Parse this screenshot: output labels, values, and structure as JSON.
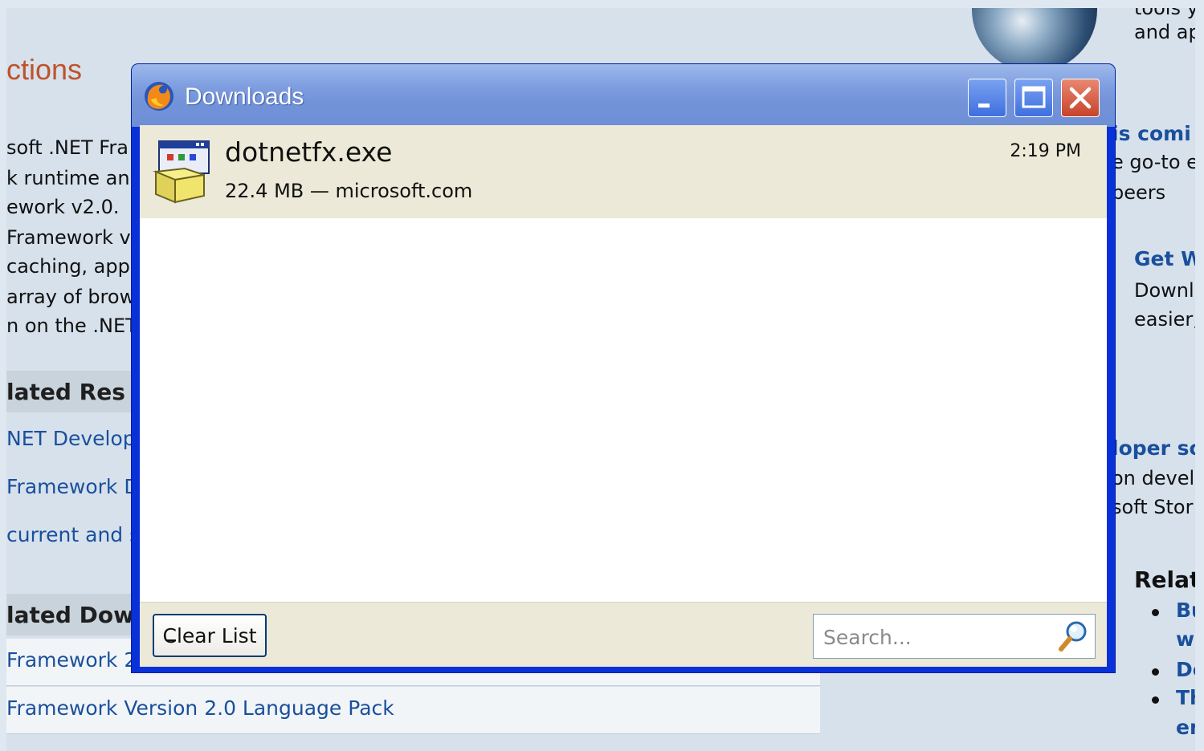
{
  "background_page": {
    "heading_fragment": "ctions",
    "desc_lines": [
      "soft .NET Fra",
      "k runtime and",
      "ework v2.0.",
      "Framework ve",
      "caching, appl",
      "array of brow",
      "n on the .NET"
    ],
    "related_resources_heading": "lated Res",
    "related_resources": [
      "NET Develope",
      "Framework D",
      "current and s"
    ],
    "related_downloads_heading": "lated Dow",
    "related_downloads": [
      "Framework 2",
      "Framework Version 2.0 Language Pack"
    ],
    "right_column": {
      "top_lines": [
        "tools y",
        "and ap"
      ],
      "coming_heading": "is comi",
      "coming_lines": [
        "e go-to e",
        "peers"
      ],
      "get_heading": "Get W",
      "get_lines": [
        "Downl",
        "easier,"
      ],
      "dev_heading": "loper so",
      "dev_lines": [
        "on devel",
        "soft Stor"
      ],
      "related_heading": "Relat",
      "related_items": [
        "Bu",
        "wi",
        "De",
        "Th",
        "en"
      ]
    }
  },
  "window": {
    "title": "Downloads",
    "buttons": {
      "minimize": "minimize",
      "maximize": "maximize",
      "close": "close"
    }
  },
  "downloads": [
    {
      "filename": "dotnetfx.exe",
      "status": "22.4 MB — microsoft.com",
      "time": "2:19 PM"
    }
  ],
  "footer": {
    "clear_list_label": "Clear List",
    "search_placeholder": "Search..."
  },
  "colors": {
    "titlebar": "#7393d9",
    "window_border": "#0831d9",
    "item_background": "#ece9d8",
    "close_button": "#c8432b",
    "link": "#1a4f9c"
  }
}
